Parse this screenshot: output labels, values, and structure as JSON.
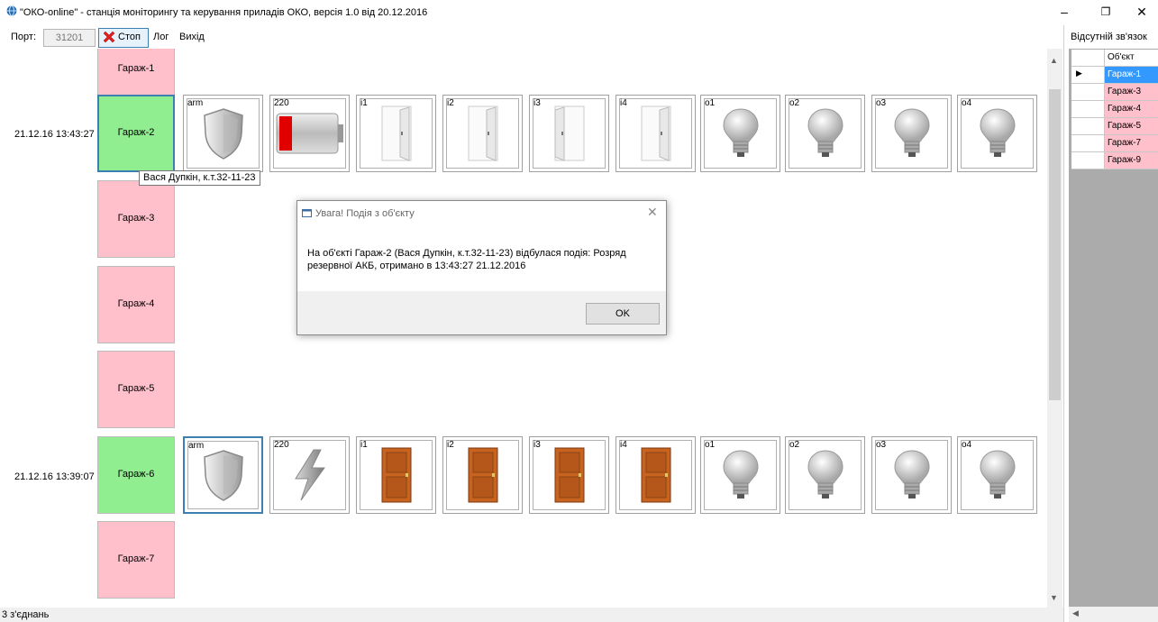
{
  "window": {
    "title": "\"ОКО-online\" - станція моніторингу та керування приладів ОКО, версія 1.0 від 20.12.2016",
    "minimize": "–",
    "maximize": "❐",
    "close": "✕"
  },
  "toolbar": {
    "port_label": "Порт:",
    "port_value": "31201",
    "stop_label": "Стоп",
    "log_label": "Лог",
    "exit_label": "Вихід"
  },
  "rows": {
    "r0": {
      "garage": "Гараж-1",
      "time": ""
    },
    "r1": {
      "garage": "Гараж-2",
      "time": "21.12.16 13:43:27"
    },
    "r2": {
      "garage": "Гараж-3",
      "time": ""
    },
    "r3": {
      "garage": "Гараж-4",
      "time": ""
    },
    "r4": {
      "garage": "Гараж-5",
      "time": ""
    },
    "r5": {
      "garage": "Гараж-6",
      "time": "21.12.16 13:39:07"
    },
    "r6": {
      "garage": "Гараж-7",
      "time": ""
    }
  },
  "tile_labels": {
    "arm": "arm",
    "p220": "220",
    "i1": "i1",
    "i2": "i2",
    "i3": "i3",
    "i4": "i4",
    "o1": "o1",
    "o2": "o2",
    "o3": "o3",
    "o4": "o4"
  },
  "tooltip": "Вася Дупкін, к.т.32-11-23",
  "dialog": {
    "title": "Увага! Подія з об'єкту",
    "message": "На об'єкті Гараж-2 (Вася Дупкін, к.т.32-11-23) відбулася подія: Розряд резервної АКБ, отримано в 13:43:27 21.12.2016",
    "ok": "OK"
  },
  "right_panel": {
    "title": "Відсутній зв'язок",
    "column": "Об'єкт",
    "items": [
      "Гараж-1",
      "Гараж-3",
      "Гараж-4",
      "Гараж-5",
      "Гараж-7",
      "Гараж-9"
    ]
  },
  "status": "3 з'єднань",
  "colors": {
    "offline": "#ffc0cb",
    "online": "#90ee90",
    "selected": "#3399ff",
    "door_wood": "#c8621f"
  },
  "icons": {
    "app": "app-globe-icon",
    "stop": "red-x-icon",
    "shield": "shield-icon",
    "battery": "battery-icon",
    "power": "lightning-icon",
    "door_open": "door-open-icon",
    "door_closed": "door-closed-icon",
    "bulb": "lightbulb-icon"
  }
}
